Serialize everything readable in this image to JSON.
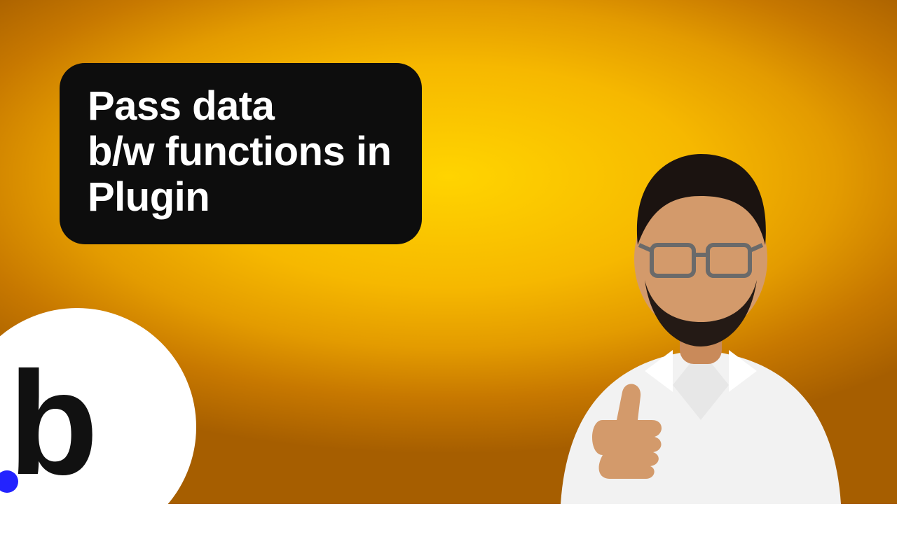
{
  "title": {
    "line1": "Pass data",
    "line2": "b/w functions in",
    "line3": "Plugin"
  },
  "logo": {
    "letter": "b",
    "dot_color": "#2323ff"
  },
  "colors": {
    "background_center": "#ffd400",
    "background_edge": "#a65e00",
    "card_bg": "#0d0d0d",
    "card_text": "#ffffff",
    "logo_circle": "#ffffff",
    "logo_letter": "#111111"
  }
}
